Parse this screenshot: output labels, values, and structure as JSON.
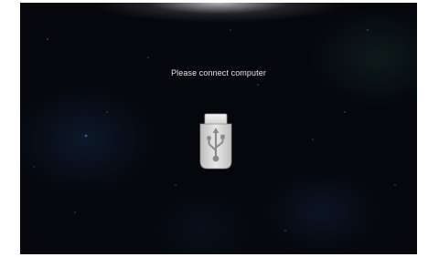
{
  "screen": {
    "message": "Please connect computer",
    "icon": "usb-plug-icon"
  }
}
